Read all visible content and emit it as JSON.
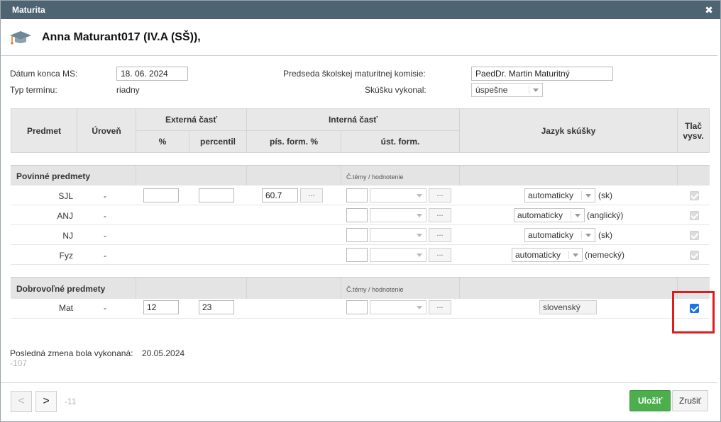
{
  "window": {
    "title": "Maturita",
    "close": "✖"
  },
  "header": {
    "student": "Anna Maturant017 (IV.A (SŠ)),",
    "icon": "graduation-cap-icon"
  },
  "form": {
    "date_label": "Dátum konca MS:",
    "date_value": "18. 06. 2024",
    "term_label": "Typ termínu:",
    "term_value": "riadny",
    "chair_label": "Predseda školskej maturitnej komisie:",
    "chair_value": "PaedDr. Martin Maturitný",
    "exam_label": "Skúšku vykonal:",
    "exam_value": "úspešne"
  },
  "table": {
    "headers": {
      "subject": "Predmet",
      "level": "Úroveň",
      "external": "Externá časť",
      "percent": "%",
      "percentile": "percentil",
      "internal": "Interná časť",
      "written": "pís. form. %",
      "oral": "úst. form.",
      "language": "Jazyk skúšky",
      "print_line1": "Tlač",
      "print_line2": "vysv."
    },
    "topics_label": "Č.témy / hodnotenie",
    "dots": "...",
    "mandatory_title": "Povinné predmety",
    "voluntary_title": "Dobrovoľné predmety",
    "mandatory": [
      {
        "name": "SJL",
        "level": "-",
        "written": "60.7",
        "lang": "automaticky",
        "code": "(sk)"
      },
      {
        "name": "ANJ",
        "level": "-",
        "lang": "automaticky",
        "code": "(anglický)"
      },
      {
        "name": "NJ",
        "level": "-",
        "lang": "automaticky",
        "code": "(sk)"
      },
      {
        "name": "Fyz",
        "level": "-",
        "lang": "automaticky",
        "code": "(nemecký)"
      }
    ],
    "voluntary": [
      {
        "name": "Mat",
        "level": "-",
        "percent": "12",
        "percentile": "23",
        "lang": "slovenský",
        "print": true
      }
    ]
  },
  "last_change": {
    "label": "Posledná zmena bola vykonaná:",
    "date": "20.05.2024",
    "id": "-107"
  },
  "footer": {
    "prev": "<",
    "next": ">",
    "counter": "-11",
    "save": "Uložiť",
    "cancel": "Zrušiť"
  },
  "colors": {
    "titlebar": "#4f6472",
    "save": "#4cae4c",
    "highlight": "#e01b1b",
    "checkbox": "#1a73e8"
  }
}
